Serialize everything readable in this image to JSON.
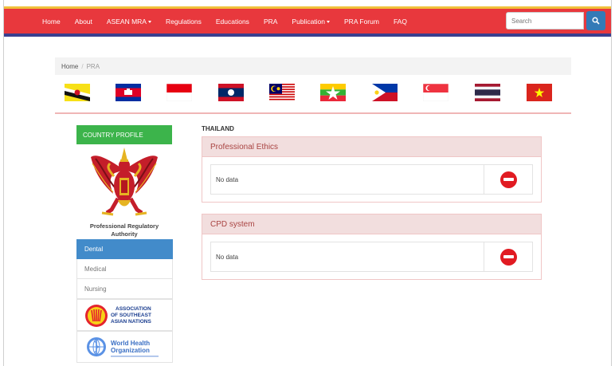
{
  "nav": {
    "items": [
      {
        "label": "Home",
        "dropdown": false
      },
      {
        "label": "About",
        "dropdown": false
      },
      {
        "label": "ASEAN MRA",
        "dropdown": true
      },
      {
        "label": "Regulations",
        "dropdown": false
      },
      {
        "label": "Educations",
        "dropdown": false
      },
      {
        "label": "PRA",
        "dropdown": false
      },
      {
        "label": "Publication",
        "dropdown": true
      },
      {
        "label": "PRA Forum",
        "dropdown": false
      },
      {
        "label": "FAQ",
        "dropdown": false
      }
    ],
    "search_placeholder": "Search",
    "colors": {
      "bar": "#e8383d",
      "top_stripe": "#f0c03a",
      "bottom_stripe": "#3a3f8f",
      "search_button": "#337ab7"
    }
  },
  "breadcrumb": {
    "home": "Home",
    "separator": "/",
    "current": "PRA"
  },
  "flags": [
    "brunei-flag",
    "cambodia-flag",
    "indonesia-flag",
    "laos-flag",
    "malaysia-flag",
    "myanmar-flag",
    "philippines-flag",
    "singapore-flag",
    "thailand-flag",
    "vietnam-flag"
  ],
  "sidebar": {
    "header": "COUNTRY PROFILE",
    "emblem": "garuda-emblem",
    "authority": "Professional Regulatory Authority",
    "menu": [
      {
        "label": "Dental",
        "active": true
      },
      {
        "label": "Medical",
        "active": false
      },
      {
        "label": "Nursing",
        "active": false
      }
    ],
    "logos": [
      {
        "icon": "asean-logo",
        "text": "ASSOCIATION OF SOUTHEAST ASIAN NATIONS"
      },
      {
        "icon": "who-logo",
        "text": "World Health Organization"
      }
    ]
  },
  "main": {
    "country": "THAILAND",
    "panels": [
      {
        "title": "Professional Ethics",
        "value": "No data"
      },
      {
        "title": "CPD system",
        "value": "No data"
      }
    ]
  }
}
